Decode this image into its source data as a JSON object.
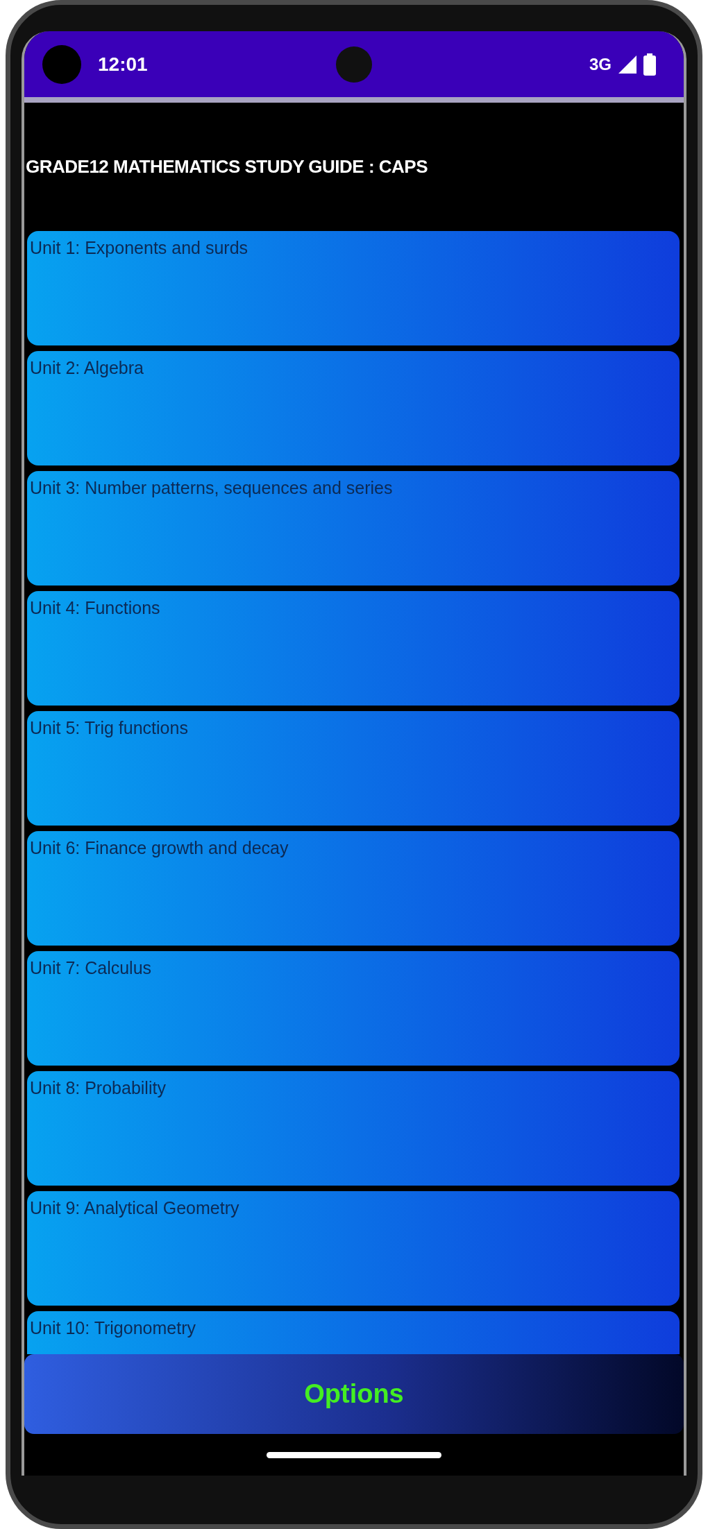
{
  "status_bar": {
    "time": "12:01",
    "network": "3G"
  },
  "title": "GRADE12 MATHEMATICS STUDY GUIDE : CAPS",
  "units": [
    {
      "label": "Unit 1: Exponents and surds"
    },
    {
      "label": "Unit 2: Algebra"
    },
    {
      "label": "Unit 3: Number patterns, sequences and series"
    },
    {
      "label": "Unit 4: Functions"
    },
    {
      "label": "Unit 5: Trig functions"
    },
    {
      "label": "Unit 6: Finance growth and decay"
    },
    {
      "label": "Unit 7: Calculus"
    },
    {
      "label": "Unit 8: Probability"
    },
    {
      "label": "Unit 9: Analytical Geometry"
    },
    {
      "label": "Unit 10: Trigonometry"
    }
  ],
  "options_button": {
    "label": "Options"
  }
}
